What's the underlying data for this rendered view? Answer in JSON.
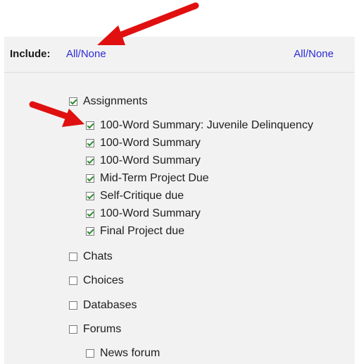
{
  "header": {
    "include_label": "Include:",
    "all_none_left": "All/None",
    "all_none_right": "All/None"
  },
  "tree": [
    {
      "label": "Assignments",
      "checked": true,
      "level": 1
    },
    {
      "label": "100-Word Summary: Juvenile Delinquency",
      "checked": true,
      "level": 2
    },
    {
      "label": "100-Word Summary",
      "checked": true,
      "level": 2
    },
    {
      "label": "100-Word Summary",
      "checked": true,
      "level": 2
    },
    {
      "label": "Mid-Term Project Due",
      "checked": true,
      "level": 2
    },
    {
      "label": "Self-Critique due",
      "checked": true,
      "level": 2
    },
    {
      "label": "100-Word Summary",
      "checked": true,
      "level": 2
    },
    {
      "label": "Final Project due",
      "checked": true,
      "level": 2
    },
    {
      "label": "Chats",
      "checked": false,
      "level": 1
    },
    {
      "label": "Choices",
      "checked": false,
      "level": 1
    },
    {
      "label": "Databases",
      "checked": false,
      "level": 1
    },
    {
      "label": "Forums",
      "checked": false,
      "level": 1
    },
    {
      "label": "News forum",
      "checked": false,
      "level": 2
    }
  ],
  "colors": {
    "link": "#2b2bd6",
    "arrow": "#e01010",
    "check": "#2e8b2e",
    "panel_bg": "#f2f2f2"
  },
  "annotations": [
    "arrow-to-all-none-link",
    "arrow-to-first-assignment-item"
  ]
}
